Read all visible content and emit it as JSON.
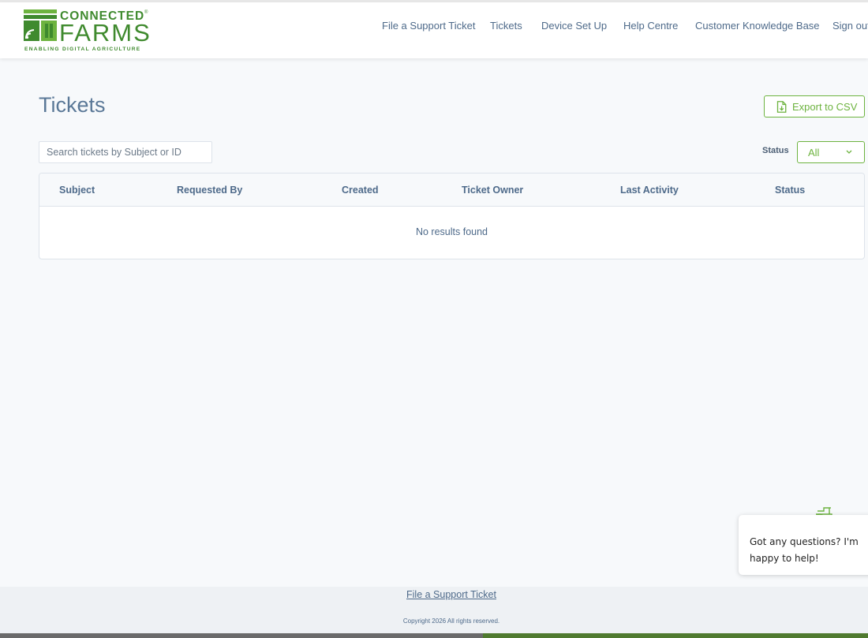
{
  "brand": {
    "name_top": "CONNECTED",
    "name_bottom": "FARMS",
    "trademark": "®",
    "tagline": "ENABLING DIGITAL AGRICULTURE",
    "color": "#3f8a2e"
  },
  "nav": {
    "items": [
      {
        "label": "File a Support Ticket"
      },
      {
        "label": "Tickets"
      },
      {
        "label": "Device Set Up"
      },
      {
        "label": "Help Centre"
      },
      {
        "label": "Customer Knowledge Base"
      },
      {
        "label": "Sign out"
      }
    ]
  },
  "page": {
    "title": "Tickets",
    "export_label": "Export to CSV",
    "accent_color": "#6db33f"
  },
  "search": {
    "placeholder": "Search tickets by Subject or ID",
    "value": ""
  },
  "filter": {
    "status_label": "Status",
    "status_value": "All"
  },
  "table": {
    "columns": [
      "Subject",
      "Requested By",
      "Created",
      "Ticket Owner",
      "Last Activity",
      "Status"
    ],
    "rows": [],
    "empty_message": "No results found"
  },
  "chat": {
    "message": "Got any questions? I'm happy to help!",
    "icon": "tractor-icon"
  },
  "footer": {
    "link_label": "File a Support Ticket",
    "copyright": "Copyright 2026 All rights reserved."
  }
}
